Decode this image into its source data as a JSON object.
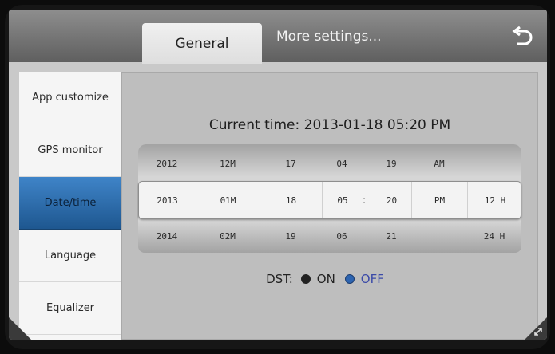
{
  "header": {
    "tabs": [
      {
        "label": "General",
        "selected": true
      },
      {
        "label": "More settings...",
        "selected": false
      }
    ],
    "back_icon": "back-arrow-icon"
  },
  "sidebar": {
    "items": [
      {
        "label": "App customize",
        "active": false
      },
      {
        "label": "GPS monitor",
        "active": false
      },
      {
        "label": "Date/time",
        "active": true
      },
      {
        "label": "Language",
        "active": false
      },
      {
        "label": "Equalizer",
        "active": false
      }
    ]
  },
  "content": {
    "current_time_label": "Current time:",
    "current_time_value": "2013-01-18 05:20 PM",
    "picker": {
      "top_row": [
        "2012",
        "12M",
        "17",
        "04",
        "19",
        "AM",
        ""
      ],
      "mid_row": [
        "2013",
        "01M",
        "18",
        "05",
        "20",
        "PM",
        "12 H"
      ],
      "bot_row": [
        "2014",
        "02M",
        "19",
        "06",
        "21",
        "",
        "24 H"
      ],
      "separator": ":"
    },
    "dst": {
      "label": "DST:",
      "on_label": "ON",
      "off_label": "OFF",
      "selected": "OFF"
    }
  },
  "colors": {
    "accent": "#2d64b0",
    "active_item": "#3f84c8"
  }
}
